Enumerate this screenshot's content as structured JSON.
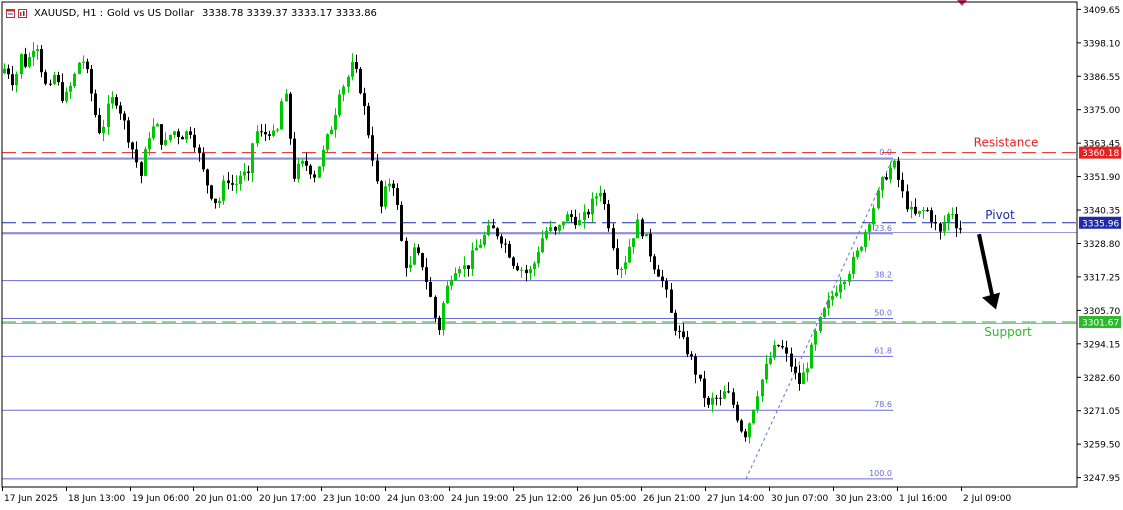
{
  "header": {
    "symbol": "XAUUSD",
    "timeframe": "H1",
    "description": "Gold vs US Dollar",
    "ohlc": "3338.78 3339.37 3333.17 3333.86"
  },
  "colors": {
    "bull": "#00c800",
    "bear": "#000000",
    "resistance": "#e62020",
    "pivot": "#1e2aa8",
    "support": "#2db82d",
    "fib": "#6a6ad6",
    "grid": "#000000",
    "fib_trend": "#6a6ad6"
  },
  "chart_data": {
    "type": "candlestick",
    "symbol": "XAUUSD, H1",
    "y_ticks": [
      "3409.65",
      "3398.10",
      "3386.55",
      "3375.00",
      "3363.45",
      "3351.90",
      "3340.35",
      "3328.80",
      "3317.25",
      "3305.70",
      "3294.15",
      "3282.60",
      "3271.05",
      "3259.50",
      "3247.95"
    ],
    "ylim": [
      3244.7,
      3412.2
    ],
    "x_ticks": [
      "17 Jun 2025",
      "18 Jun 13:00",
      "19 Jun 06:00",
      "20 Jun 01:00",
      "20 Jun 17:00",
      "23 Jun 10:00",
      "24 Jun 03:00",
      "24 Jun 19:00",
      "25 Jun 12:00",
      "26 Jun 05:00",
      "26 Jun 21:00",
      "27 Jun 14:00",
      "30 Jun 07:00",
      "30 Jun 23:00",
      "1 Jul 16:00",
      "2 Jul 09:00"
    ],
    "levels": [
      {
        "label": "Resistance",
        "price": 3360.18,
        "price_label": "3360.18",
        "style": "dashed",
        "color_key": "resistance"
      },
      {
        "label": "Pivot",
        "price": 3335.96,
        "price_label": "3335.96",
        "style": "dashed",
        "color_key": "pivot"
      },
      {
        "label": "Support",
        "price": 3301.67,
        "price_label": "3301.67",
        "style": "dashed",
        "color_key": "support"
      }
    ],
    "fibonacci": {
      "high": 3358.3,
      "low": 3247.5,
      "levels": [
        {
          "label": "0.0",
          "ratio": 0.0
        },
        {
          "label": "23.6",
          "ratio": 0.236
        },
        {
          "label": "38.2",
          "ratio": 0.382
        },
        {
          "label": "50.0",
          "ratio": 0.5
        },
        {
          "label": "61.8",
          "ratio": 0.618
        },
        {
          "label": "78.6",
          "ratio": 0.786
        },
        {
          "label": "100.0",
          "ratio": 1.0
        }
      ]
    },
    "extra_lines": [
      3357.9,
      3332.6,
      3301.2
    ],
    "path": [
      [
        0,
        3386
      ],
      [
        10,
        3390
      ],
      [
        18,
        3384
      ],
      [
        25,
        3394
      ],
      [
        30,
        3390
      ],
      [
        40,
        3400
      ],
      [
        46,
        3388
      ],
      [
        52,
        3380
      ],
      [
        58,
        3387
      ],
      [
        68,
        3378
      ],
      [
        76,
        3384
      ],
      [
        85,
        3394
      ],
      [
        92,
        3386
      ],
      [
        100,
        3372
      ],
      [
        105,
        3366
      ],
      [
        110,
        3374
      ],
      [
        118,
        3380
      ],
      [
        125,
        3374
      ],
      [
        132,
        3366
      ],
      [
        138,
        3360
      ],
      [
        145,
        3352
      ],
      [
        152,
        3366
      ],
      [
        160,
        3370
      ],
      [
        168,
        3362
      ],
      [
        176,
        3368
      ],
      [
        185,
        3366
      ],
      [
        195,
        3368
      ],
      [
        202,
        3360
      ],
      [
        208,
        3352
      ],
      [
        215,
        3346
      ],
      [
        222,
        3342
      ],
      [
        230,
        3352
      ],
      [
        238,
        3348
      ],
      [
        246,
        3354
      ],
      [
        252,
        3350
      ],
      [
        258,
        3368
      ],
      [
        266,
        3366
      ],
      [
        274,
        3368
      ],
      [
        280,
        3364
      ],
      [
        288,
        3384
      ],
      [
        293,
        3368
      ],
      [
        298,
        3352
      ],
      [
        304,
        3356
      ],
      [
        312,
        3356
      ],
      [
        318,
        3352
      ],
      [
        325,
        3358
      ],
      [
        332,
        3366
      ],
      [
        338,
        3372
      ],
      [
        343,
        3382
      ],
      [
        349,
        3384
      ],
      [
        356,
        3390
      ],
      [
        362,
        3386
      ],
      [
        368,
        3376
      ],
      [
        374,
        3364
      ],
      [
        379,
        3354
      ],
      [
        384,
        3340
      ],
      [
        390,
        3348
      ],
      [
        396,
        3352
      ],
      [
        402,
        3340
      ],
      [
        406,
        3328
      ],
      [
        412,
        3318
      ],
      [
        418,
        3326
      ],
      [
        426,
        3322
      ],
      [
        432,
        3314
      ],
      [
        437,
        3306
      ],
      [
        442,
        3298
      ],
      [
        448,
        3310
      ],
      [
        455,
        3318
      ],
      [
        462,
        3322
      ],
      [
        470,
        3320
      ],
      [
        478,
        3326
      ],
      [
        486,
        3330
      ],
      [
        494,
        3334
      ],
      [
        502,
        3332
      ],
      [
        510,
        3328
      ],
      [
        518,
        3322
      ],
      [
        526,
        3320
      ],
      [
        532,
        3318
      ],
      [
        538,
        3322
      ],
      [
        545,
        3330
      ],
      [
        552,
        3334
      ],
      [
        560,
        3332
      ],
      [
        568,
        3338
      ],
      [
        576,
        3338
      ],
      [
        584,
        3336
      ],
      [
        592,
        3340
      ],
      [
        598,
        3344
      ],
      [
        604,
        3348
      ],
      [
        610,
        3340
      ],
      [
        616,
        3330
      ],
      [
        622,
        3320
      ],
      [
        628,
        3322
      ],
      [
        635,
        3330
      ],
      [
        642,
        3336
      ],
      [
        650,
        3330
      ],
      [
        657,
        3322
      ],
      [
        664,
        3318
      ],
      [
        670,
        3312
      ],
      [
        676,
        3302
      ],
      [
        682,
        3298
      ],
      [
        688,
        3294
      ],
      [
        694,
        3290
      ],
      [
        700,
        3284
      ],
      [
        706,
        3278
      ],
      [
        712,
        3272
      ],
      [
        718,
        3276
      ],
      [
        724,
        3274
      ],
      [
        730,
        3278
      ],
      [
        736,
        3274
      ],
      [
        742,
        3268
      ],
      [
        748,
        3262
      ],
      [
        754,
        3268
      ],
      [
        760,
        3276
      ],
      [
        766,
        3282
      ],
      [
        772,
        3288
      ],
      [
        778,
        3292
      ],
      [
        784,
        3294
      ],
      [
        790,
        3290
      ],
      [
        796,
        3286
      ],
      [
        802,
        3280
      ],
      [
        808,
        3284
      ],
      [
        814,
        3290
      ],
      [
        820,
        3298
      ],
      [
        826,
        3304
      ],
      [
        832,
        3308
      ],
      [
        838,
        3312
      ],
      [
        844,
        3316
      ],
      [
        850,
        3318
      ],
      [
        856,
        3322
      ],
      [
        862,
        3326
      ],
      [
        868,
        3332
      ],
      [
        874,
        3338
      ],
      [
        880,
        3344
      ],
      [
        886,
        3350
      ],
      [
        892,
        3354
      ],
      [
        898,
        3356
      ],
      [
        903,
        3350
      ],
      [
        908,
        3344
      ],
      [
        914,
        3340
      ],
      [
        920,
        3338
      ],
      [
        926,
        3340
      ],
      [
        932,
        3340
      ],
      [
        938,
        3336
      ],
      [
        944,
        3332
      ],
      [
        950,
        3338
      ],
      [
        956,
        3340
      ],
      [
        962,
        3334
      ]
    ]
  },
  "annotations": {
    "resistance_label": "Resistance",
    "pivot_label": "Pivot",
    "support_label": "Support"
  }
}
